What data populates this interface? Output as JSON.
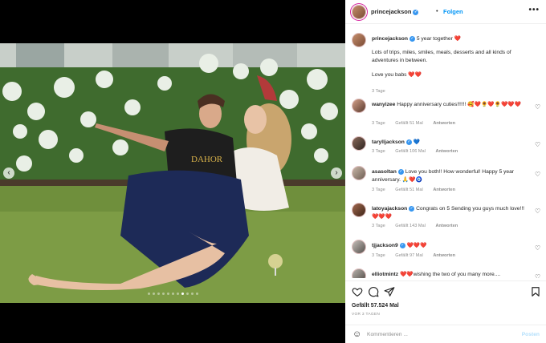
{
  "header": {
    "username": "princejackson",
    "separator": "•",
    "follow_label": "Folgen",
    "more_label": "•••"
  },
  "caption": {
    "username": "princejackson",
    "title": "5 year together ❤️",
    "body_1": "Lots of trips, miles, smiles, meals, desserts and all kinds of adventures in between.",
    "body_2": "Love you babs ❤️❤️",
    "time": "3 Tage"
  },
  "comments": [
    {
      "username": "wanyizee",
      "text": "Happy anniversary cuties!!!!!! 🥰❤️🌻❤️🌻❤️❤️❤️",
      "time": "3 Tage",
      "likes": "Gefällt 51 Mal",
      "reply": "Antworten"
    },
    {
      "username": "tarylljackson",
      "text": "💙",
      "time": "3 Tage",
      "likes": "Gefällt 106 Mal",
      "reply": "Antworten"
    },
    {
      "username": "asasoltan",
      "text": "Love you both!! How wonderful! Happy 5 year anniversary. 🙏❤️🧿",
      "time": "3 Tage",
      "likes": "Gefällt 51 Mal",
      "reply": "Antworten"
    },
    {
      "username": "latoyajackson",
      "text": "Congrats on 5 Sending you guys much love!!! ❤️❤️❤️",
      "time": "3 Tage",
      "likes": "Gefällt 143 Mal",
      "reply": "Antworten"
    },
    {
      "username": "tjjackson9",
      "text": "❤️❤️❤️",
      "time": "3 Tage",
      "likes": "Gefällt 97 Mal",
      "reply": "Antworten"
    },
    {
      "username": "elliotmintz",
      "text": "❤️❤️wishing the two of you many more....",
      "time": "",
      "likes": "",
      "reply": ""
    }
  ],
  "likes_count": "Gefällt 57.524 Mal",
  "posted": "VOR 3 TAGEN",
  "comment_input": {
    "placeholder": "Kommentieren ...",
    "post_label": "Posten"
  },
  "carousel": {
    "prev": "‹",
    "next": "›",
    "slides": 11,
    "active_slide": 8
  },
  "icons": {
    "like": "heart-outline-icon",
    "comment": "speech-bubble-icon",
    "share": "paper-plane-icon",
    "save": "bookmark-icon",
    "emoji": "smiley-icon",
    "verified": "verified-badge-icon",
    "comment_like": "small-heart-icon"
  },
  "colors": {
    "accent": "#0095f6",
    "verified": "#3897f0",
    "meta": "#8e8e8e",
    "heart": "#ed4956",
    "post_disabled": "#b2dffc"
  }
}
